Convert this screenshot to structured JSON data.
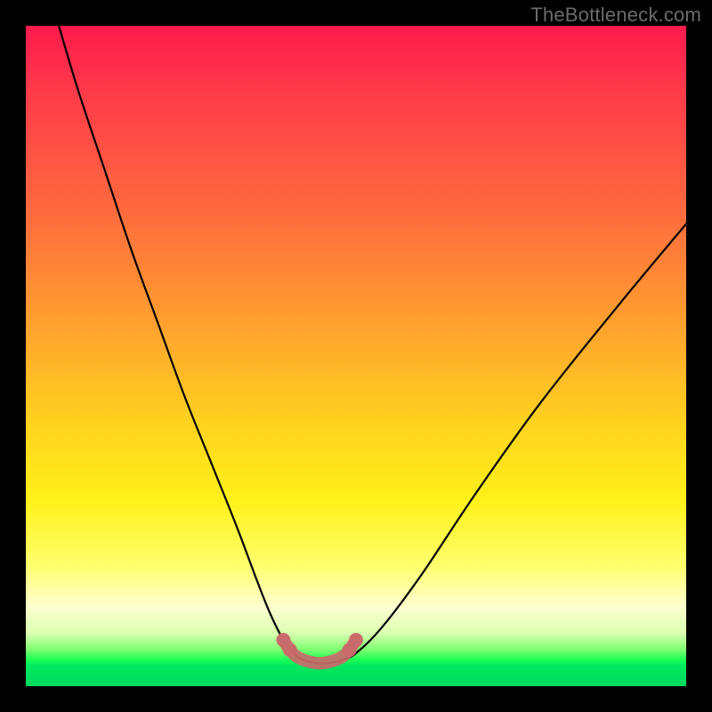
{
  "watermark": "TheBottleneck.com",
  "chart_data": {
    "type": "line",
    "title": "",
    "xlabel": "",
    "ylabel": "",
    "xlim": [
      0,
      100
    ],
    "ylim": [
      0,
      100
    ],
    "series": [
      {
        "name": "bottleneck-curve",
        "x": [
          5,
          8,
          12,
          16,
          20,
          24,
          28,
          32,
          35,
          37,
          39,
          40.5,
          42,
          44,
          46,
          48,
          50,
          54,
          60,
          68,
          78,
          90,
          100
        ],
        "y": [
          100,
          90,
          78,
          66,
          55,
          44,
          34,
          24,
          16,
          11,
          7,
          5,
          4,
          3.5,
          3.5,
          4,
          5,
          9,
          17,
          29,
          43,
          58,
          70
        ]
      },
      {
        "name": "valley-marker",
        "x": [
          39,
          40,
          41,
          42,
          43,
          44,
          45,
          46,
          47,
          48,
          49,
          50
        ],
        "y": [
          7,
          5.5,
          4.5,
          4,
          3.7,
          3.5,
          3.5,
          3.7,
          4,
          4.5,
          5.5,
          7
        ]
      }
    ],
    "colors": {
      "curve": "#000000",
      "marker": "#c96a6a",
      "gradient_top": "#ff1a4d",
      "gradient_mid": "#fff11a",
      "gradient_bottom": "#00d860"
    }
  }
}
